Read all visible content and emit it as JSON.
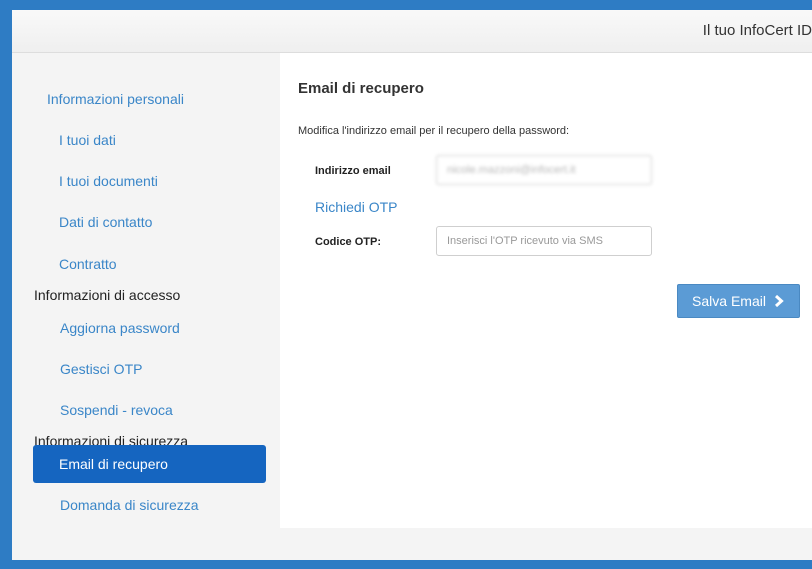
{
  "header": {
    "title": "Il tuo InfoCert ID"
  },
  "sidebar": {
    "items": [
      {
        "label": "Informazioni personali"
      },
      {
        "label": "I tuoi dati"
      },
      {
        "label": "I tuoi documenti"
      },
      {
        "label": "Dati di contatto"
      },
      {
        "label": "Contratto"
      }
    ],
    "sections": [
      {
        "label": "Informazioni di accesso"
      },
      {
        "label": "Informazioni di sicurezza"
      }
    ],
    "access_items": [
      {
        "label": "Aggiorna password"
      },
      {
        "label": "Gestisci OTP"
      },
      {
        "label": "Sospendi - revoca"
      }
    ],
    "security_items": [
      {
        "label": "Email di recupero",
        "active": true
      },
      {
        "label": "Domanda di sicurezza"
      }
    ]
  },
  "main": {
    "title": "Email di recupero",
    "description": "Modifica l'indirizzo email per il recupero della password:",
    "email_label": "Indirizzo email",
    "email_value": "nicole.mazzoni@infocert.it",
    "request_otp_link": "Richiedi OTP",
    "otp_label": "Codice OTP:",
    "otp_placeholder": "Inserisci l'OTP ricevuto via SMS",
    "save_button_label": "Salva Email"
  },
  "colors": {
    "accent": "#1565c0",
    "link": "#3a86c8",
    "button": "#5b9bd5",
    "frame": "#2e7cc4"
  },
  "icons": {
    "save_button_icon": "chevron-right-icon"
  }
}
